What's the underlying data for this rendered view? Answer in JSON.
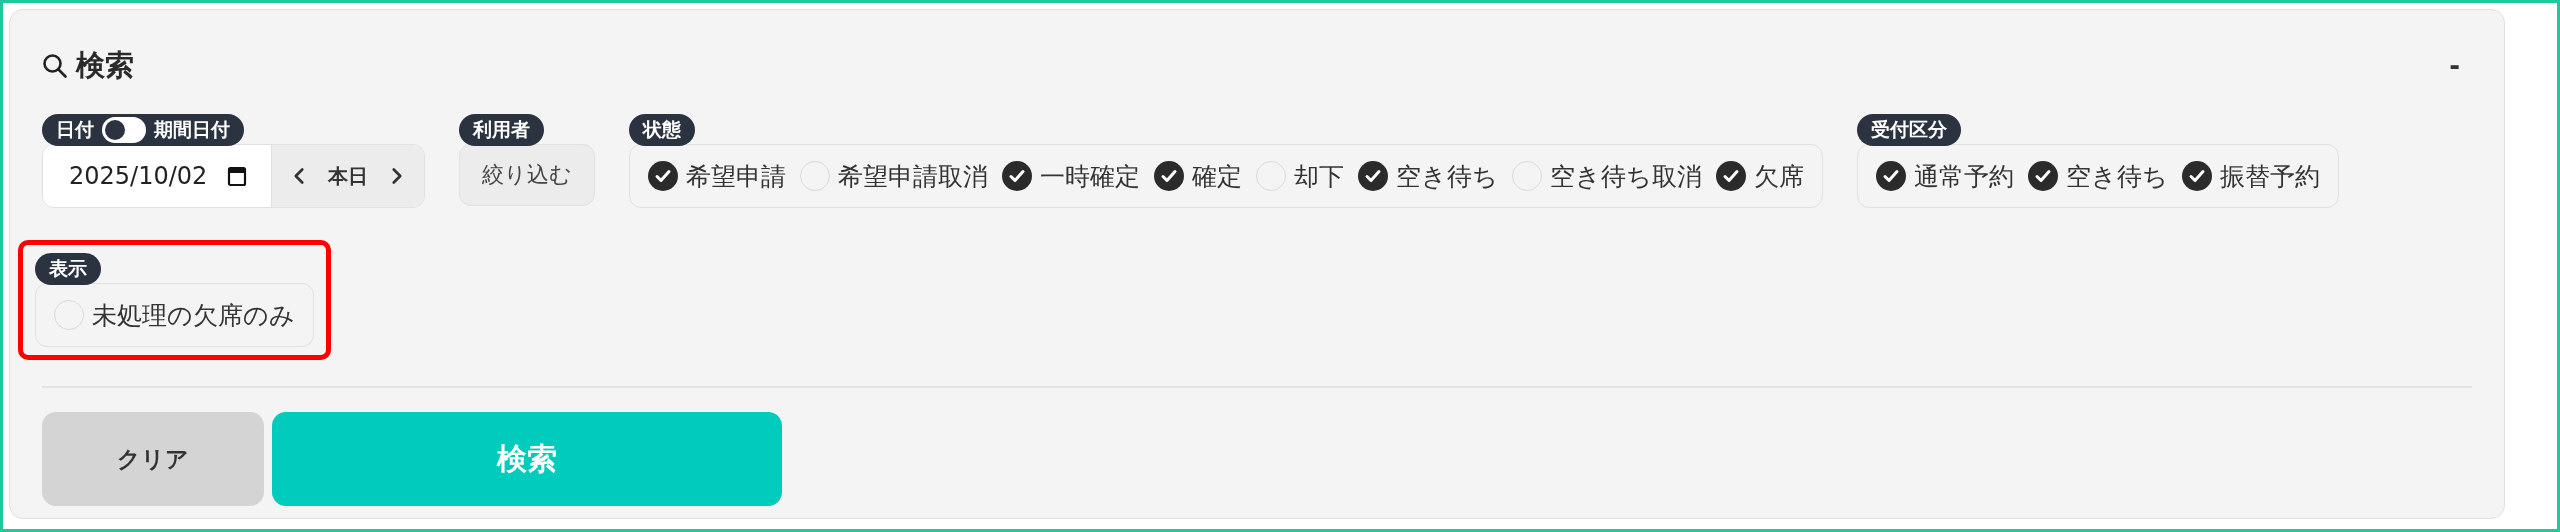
{
  "panel": {
    "title": "検索",
    "collapse_label": "-"
  },
  "filters": [
    {
      "kind": "date",
      "label_left": "日付",
      "label_right": "期間日付",
      "range_mode": false,
      "value": "2025/10/02",
      "today_label": "本日"
    },
    {
      "kind": "button",
      "label": "利用者",
      "button": "絞り込む"
    },
    {
      "kind": "checks",
      "label": "状態",
      "options": [
        {
          "label": "希望申請",
          "checked": true
        },
        {
          "label": "希望申請取消",
          "checked": false
        },
        {
          "label": "一時確定",
          "checked": true
        },
        {
          "label": "確定",
          "checked": true
        },
        {
          "label": "却下",
          "checked": false
        },
        {
          "label": "空き待ち",
          "checked": true
        },
        {
          "label": "空き待ち取消",
          "checked": false
        },
        {
          "label": "欠席",
          "checked": true
        }
      ]
    },
    {
      "kind": "checks",
      "label": "受付区分",
      "options": [
        {
          "label": "通常予約",
          "checked": true
        },
        {
          "label": "空き待ち",
          "checked": true
        },
        {
          "label": "振替予約",
          "checked": true
        }
      ]
    },
    {
      "kind": "checks",
      "label": "表示",
      "highlighted": true,
      "options": [
        {
          "label": "未処理の欠席のみ",
          "checked": false
        }
      ]
    }
  ],
  "actions": [
    {
      "kind": "secondary",
      "label": "クリア"
    },
    {
      "kind": "primary",
      "label": "検索"
    }
  ]
}
